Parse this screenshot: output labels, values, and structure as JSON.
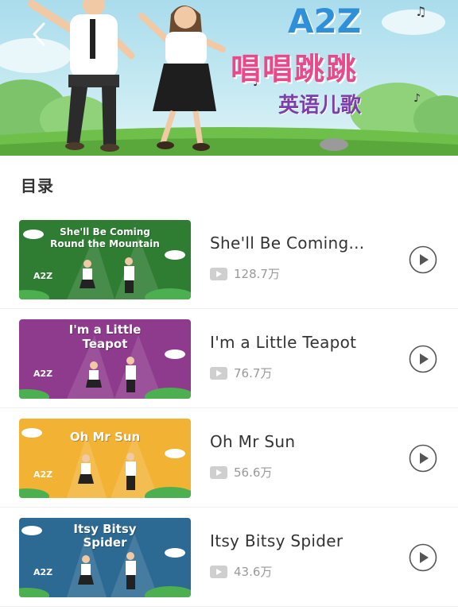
{
  "banner": {
    "logo_text": "A2Z",
    "title": "唱唱跳跳",
    "subtitle": "英语儿歌"
  },
  "section": {
    "title": "目录"
  },
  "songs": [
    {
      "thumb_title_line1": "She'll Be Coming",
      "thumb_title_line2": "Round the Mountain",
      "title": "She'll Be Coming...",
      "views": "128.7万",
      "thumb_color": "#2e7d32"
    },
    {
      "thumb_title_line1": "I'm a Little",
      "thumb_title_line2": "Teapot",
      "title": "I'm a Little Teapot",
      "views": "76.7万",
      "thumb_color": "#8e3b8e"
    },
    {
      "thumb_title_line1": "Oh Mr Sun",
      "thumb_title_line2": "",
      "title": "Oh Mr Sun",
      "views": "56.6万",
      "thumb_color": "#f2b233"
    },
    {
      "thumb_title_line1": "Itsy Bitsy",
      "thumb_title_line2": "Spider",
      "title": "Itsy Bitsy Spider",
      "views": "43.6万",
      "thumb_color": "#2d6a93"
    }
  ],
  "thumb_badge": "A2Z",
  "icons": {
    "back": "chevron-left-icon",
    "play": "play-circle-icon",
    "views": "video-icon"
  }
}
